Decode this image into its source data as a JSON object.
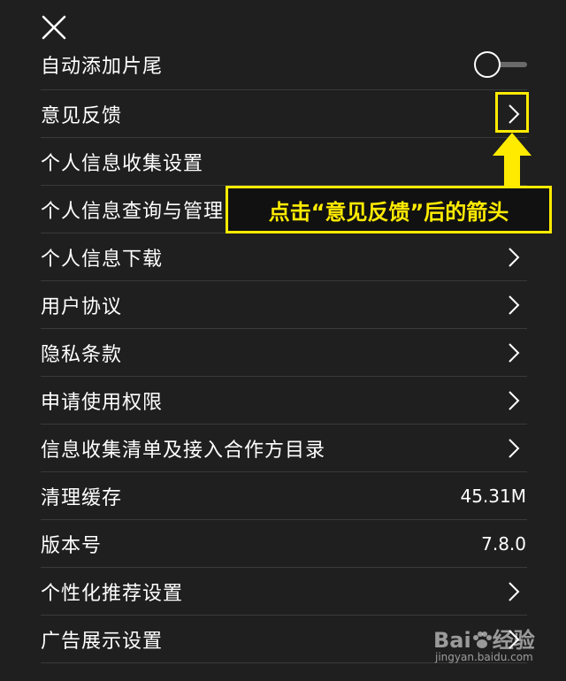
{
  "header": {
    "close_icon": "close-icon"
  },
  "settings": {
    "items": [
      {
        "label": "自动添加片尾",
        "control": "toggle",
        "toggle_on": false
      },
      {
        "label": "意见反馈",
        "control": "chevron"
      },
      {
        "label": "个人信息收集设置",
        "control": "none"
      },
      {
        "label": "个人信息查询与管理",
        "control": "chevron"
      },
      {
        "label": "个人信息下载",
        "control": "chevron"
      },
      {
        "label": "用户协议",
        "control": "chevron"
      },
      {
        "label": "隐私条款",
        "control": "chevron"
      },
      {
        "label": "申请使用权限",
        "control": "chevron"
      },
      {
        "label": "信息收集清单及接入合作方目录",
        "control": "chevron"
      },
      {
        "label": "清理缓存",
        "control": "value",
        "value": "45.31M"
      },
      {
        "label": "版本号",
        "control": "value",
        "value": "7.8.0"
      },
      {
        "label": "个性化推荐设置",
        "control": "chevron"
      },
      {
        "label": "广告展示设置",
        "control": "chevron"
      }
    ]
  },
  "annotation": {
    "callout_text": "点击“意见反馈”后的箭头",
    "highlight_color": "#ffeb00"
  },
  "watermark": {
    "logo_text_left": "Bai",
    "logo_text_right": "经验",
    "url": "jingyan.baidu.com"
  },
  "colors": {
    "background": "#1f1f1f",
    "text": "#ffffff",
    "divider": "#3a3a3a",
    "accent_yellow": "#ffeb00"
  }
}
